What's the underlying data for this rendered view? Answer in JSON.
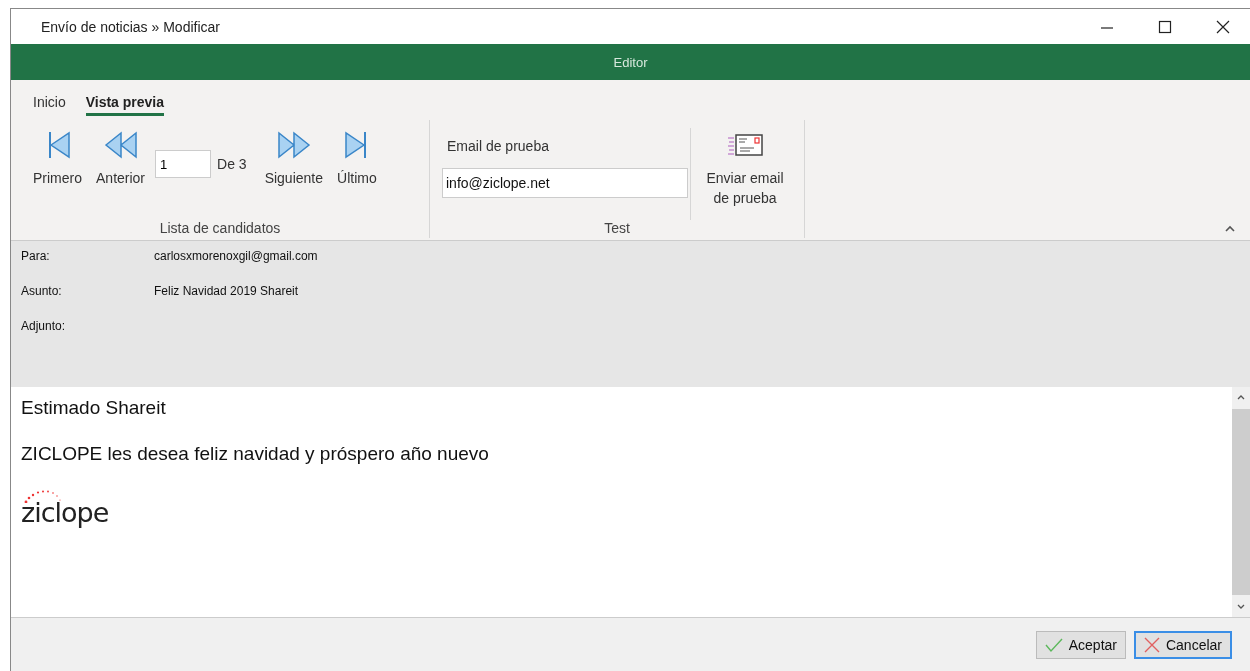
{
  "window": {
    "title": "Envío de noticias » Modificar"
  },
  "header_bar": {
    "title": "Editor"
  },
  "tabs": [
    {
      "label": "Inicio",
      "selected": false
    },
    {
      "label": "Vista previa",
      "selected": true
    }
  ],
  "ribbon": {
    "groups": [
      {
        "kind": "navigation",
        "label": "Lista de candidatos",
        "buttons": [
          {
            "label": "Primero",
            "kind": "first"
          },
          {
            "label": "Anterior",
            "kind": "prev"
          }
        ],
        "page_field": {
          "value": "1"
        },
        "page_total": "De 3",
        "buttons_after": [
          {
            "label": "Siguiente",
            "kind": "next"
          },
          {
            "label": "Último",
            "kind": "last"
          }
        ]
      },
      {
        "kind": "test",
        "label": "Test",
        "field_label": "Email de prueba",
        "field": {
          "value": "info@ziclope.net"
        },
        "send_button": {
          "label": "Enviar email de prueba"
        }
      }
    ]
  },
  "message_header": [
    {
      "label": "Para:",
      "value": "carlosxmorenoxgil@gmail.com"
    },
    {
      "label": "Asunto:",
      "value": "Feliz Navidad 2019 Shareit"
    },
    {
      "label": "Adjunto:"
    }
  ],
  "message_body": {
    "paragraphs": [
      "Estimado Shareit",
      "ZICLOPE les desea feliz navidad y próspero año nuevo"
    ],
    "logo": "ziclope"
  },
  "buttons": [
    {
      "label": "Aceptar",
      "kind": "ok"
    },
    {
      "label": "Cancelar",
      "kind": "cancel"
    }
  ]
}
